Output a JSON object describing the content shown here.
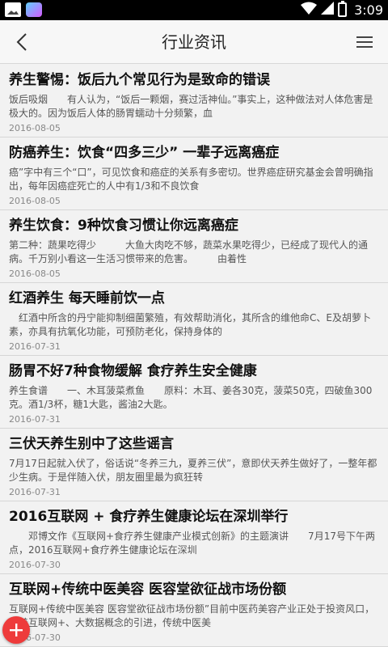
{
  "status_bar": {
    "time": "3:09"
  },
  "app_bar": {
    "title": "行业资讯",
    "back_icon": "back-arrow-icon",
    "menu_icon": "hamburger-menu-icon"
  },
  "articles": [
    {
      "title": "养生警惕：饭后九个常见行为是致命的错误",
      "summary": "饭后吸烟　　有人认为，“饭后一颗烟，赛过活神仙。”事实上，这种做法对人体危害是极大的。因为饭后人体的肠胃蠕动十分频繁，血",
      "date": "2016-08-05"
    },
    {
      "title": "防癌养生：饮食“四多三少” 一辈子远离癌症",
      "summary": "癌”字中有三个“口”，可见饮食和癌症的关系有多密切。世界癌症研究基金会曾明确指出，每年因癌症死亡的人中有1/3和不良饮食",
      "date": "2016-08-05"
    },
    {
      "title": "养生饮食：9种饮食习惯让你远离癌症",
      "summary": "第二种：蔬果吃得少　　　大鱼大肉吃不够，蔬菜水果吃得少，已经成了现代人的通病。千万别小看这一生活习惯带来的危害。　　　由着性",
      "date": "2016-08-05"
    },
    {
      "title": "红酒养生 每天睡前饮一点",
      "summary": "　红酒中所含的丹宁能抑制细菌繁殖，有效帮助消化，其所含的维他命C、E及胡萝卜素，亦具有抗氧化功能，可预防老化，保持身体的",
      "date": "2016-07-31"
    },
    {
      "title": "肠胃不好7种食物缓解 食疗养生安全健康",
      "summary": "养生食谱　　一、木耳菠菜煮鱼　　原料：木耳、姜各30克，菠菜50克，四破鱼300克。酒1/3杯，糖1大匙，酱油2大匙。",
      "date": "2016-07-31"
    },
    {
      "title": "三伏天养生别中了这些谣言",
      "summary": "7月17日起就入伏了，俗话说“冬养三九，夏养三伏”，意即伏天养生做好了，一整年都少生病。于是伴随入伏，朋友圈里最为疯狂转",
      "date": "2016-07-31"
    },
    {
      "title": "2016互联网 + 食疗养生健康论坛在深圳举行",
      "summary": "　　邓博文作《互联网+食疗养生健康产业模式创新》的主题演讲　　7月17号下午两点，2016互联网+食疗养生健康论坛在深圳",
      "date": "2016-07-30"
    },
    {
      "title": "互联网+传统中医美容 医容堂欲征战市场份额",
      "summary": "互联网+传统中医美容 医容堂欲征战市场份额”目前中医药美容产业正处于投资风口，随着互联网+、大数据概念的引进，传统中医美",
      "date": "2016-07-30"
    }
  ],
  "fab": {
    "icon": "plus-icon"
  },
  "colors": {
    "fab": "#ee3b3b",
    "background": "#f2f2f2",
    "app_bar": "#f7f7f7"
  }
}
